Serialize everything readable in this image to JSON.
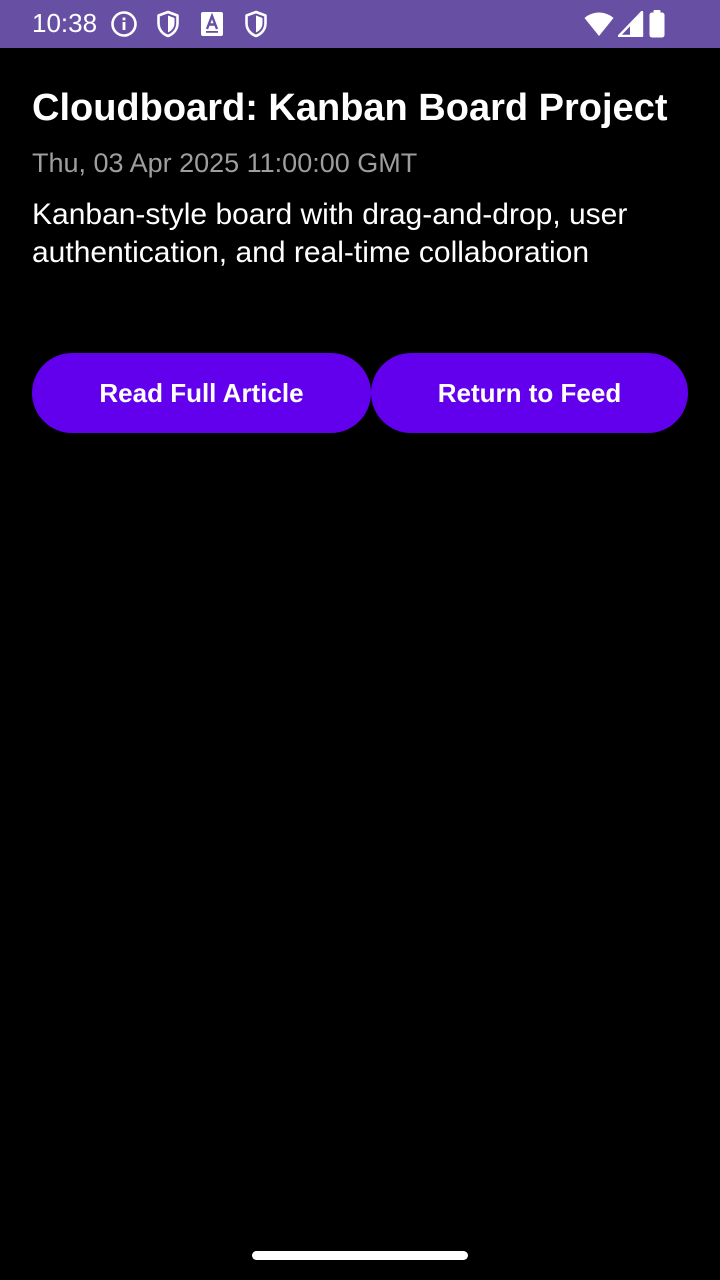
{
  "status_bar": {
    "time": "10:38",
    "left_icons": [
      "info-icon",
      "shield-icon",
      "text-a-icon",
      "shield-icon"
    ],
    "right_icons": [
      "wifi-icon",
      "signal-icon",
      "battery-icon"
    ],
    "background": "#6750a4"
  },
  "article": {
    "title": "Cloudboard: Kanban Board Project",
    "date": "Thu, 03 Apr 2025 11:00:00 GMT",
    "description": "Kanban-style board with drag-and-drop, user authentication, and real-time collaboration"
  },
  "actions": {
    "read_label": "Read Full Article",
    "return_label": "Return to Feed",
    "accent": "#6200ee"
  }
}
